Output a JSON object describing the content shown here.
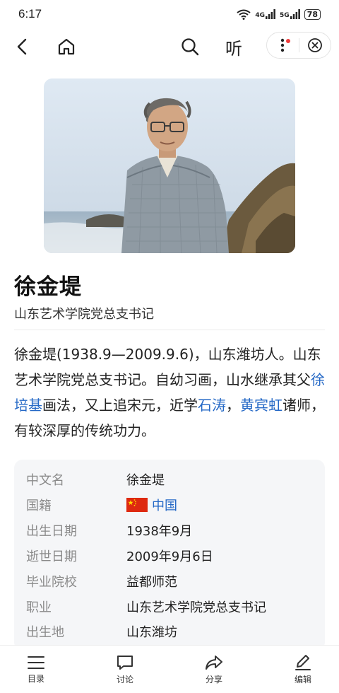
{
  "status": {
    "time": "6:17",
    "network1": "4G",
    "network2": "5G",
    "battery": "78"
  },
  "nav": {
    "listen_label": "听"
  },
  "entry": {
    "title": "徐金堤",
    "subtitle": "山东艺术学院党总支书记"
  },
  "summary": {
    "p1": "徐金堤(1938.9—2009.9.6)，山东潍坊人。山东艺术学院党总支书记。自幼习画，山水继承其父",
    "link1": "徐培基",
    "p2": "画法，又上追宋元，近学",
    "link2": "石涛",
    "p3": "，",
    "link3": "黄宾虹",
    "p4": "诸师，有较深厚的传统功力。"
  },
  "info": {
    "rows": [
      {
        "key": "中文名",
        "value": "徐金堤"
      },
      {
        "key": "国籍",
        "value": "中国"
      },
      {
        "key": "出生日期",
        "value": "1938年9月"
      },
      {
        "key": "逝世日期",
        "value": "2009年9月6日"
      },
      {
        "key": "毕业院校",
        "value": "益都师范"
      },
      {
        "key": "职业",
        "value": "山东艺术学院党总支书记"
      },
      {
        "key": "出生地",
        "value": "山东潍坊"
      }
    ]
  },
  "bottom_tabs": [
    {
      "label": "目录",
      "icon": "menu-icon"
    },
    {
      "label": "讨论",
      "icon": "comment-icon"
    },
    {
      "label": "分享",
      "icon": "share-icon"
    },
    {
      "label": "编辑",
      "icon": "edit-icon"
    }
  ],
  "colors": {
    "link": "#2468c6",
    "card_bg": "#f5f6f8",
    "badge_dot": "#f03c3c"
  }
}
